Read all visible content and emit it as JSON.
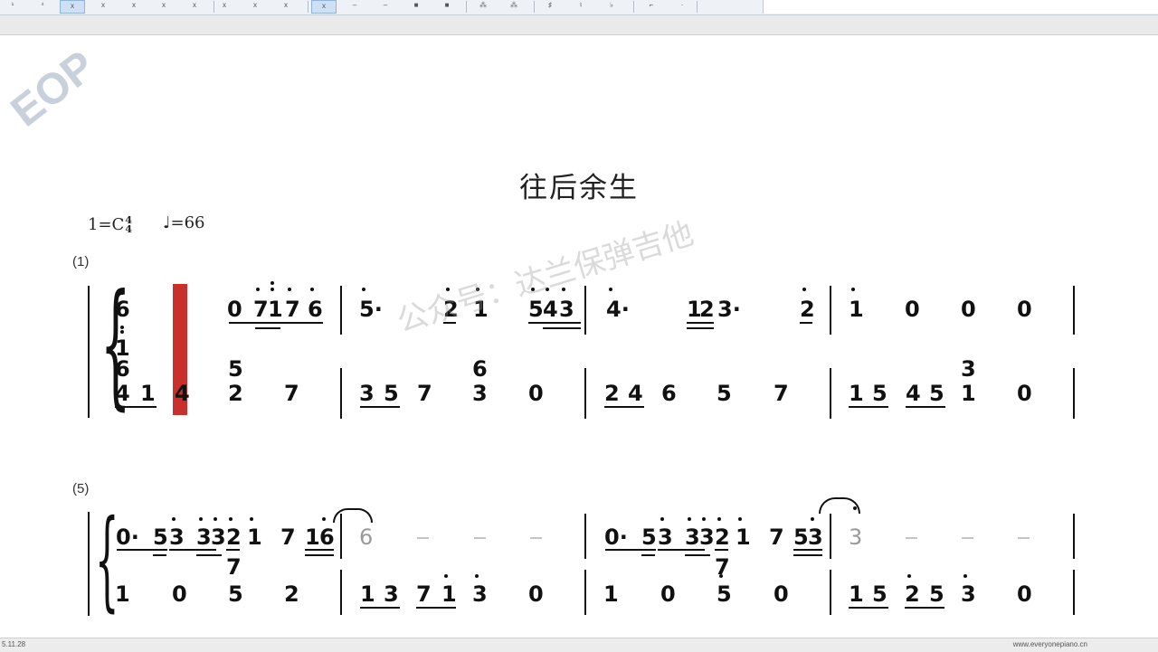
{
  "toolbar": {
    "buttons": [
      {
        "label": "¹",
        "active": false
      },
      {
        "label": "⁴",
        "active": false
      },
      {
        "label": "x",
        "active": true
      },
      {
        "label": "x",
        "active": false
      },
      {
        "label": "x",
        "active": false
      },
      {
        "label": "x",
        "active": false
      },
      {
        "label": "x",
        "active": false
      },
      {
        "label": "x",
        "active": false
      },
      {
        "label": "x",
        "active": false
      },
      {
        "label": "x",
        "active": false
      },
      {
        "label": "x",
        "active": true
      },
      {
        "label": "–",
        "active": false
      },
      {
        "label": "–",
        "active": false
      },
      {
        "label": "■",
        "active": false
      },
      {
        "label": "■",
        "active": false
      },
      {
        "label": "⁂",
        "active": false
      },
      {
        "label": "⁂",
        "active": false
      },
      {
        "label": "♯",
        "active": false
      },
      {
        "label": "♮",
        "active": false
      },
      {
        "label": "♭",
        "active": false
      },
      {
        "label": "⌐",
        "active": false
      },
      {
        "label": "·",
        "active": false
      }
    ]
  },
  "logo": {
    "text": "EOP"
  },
  "score": {
    "title": "往后余生",
    "key": "1=C",
    "time_top": "4",
    "time_bottom": "4",
    "tempo": "=66",
    "measure_numbers": [
      "(1)",
      "(5)"
    ],
    "watermark": "公众号：达兰保弹吉他"
  },
  "status": {
    "left": "5.11.28",
    "right": "www.everyonepiano.cn"
  }
}
